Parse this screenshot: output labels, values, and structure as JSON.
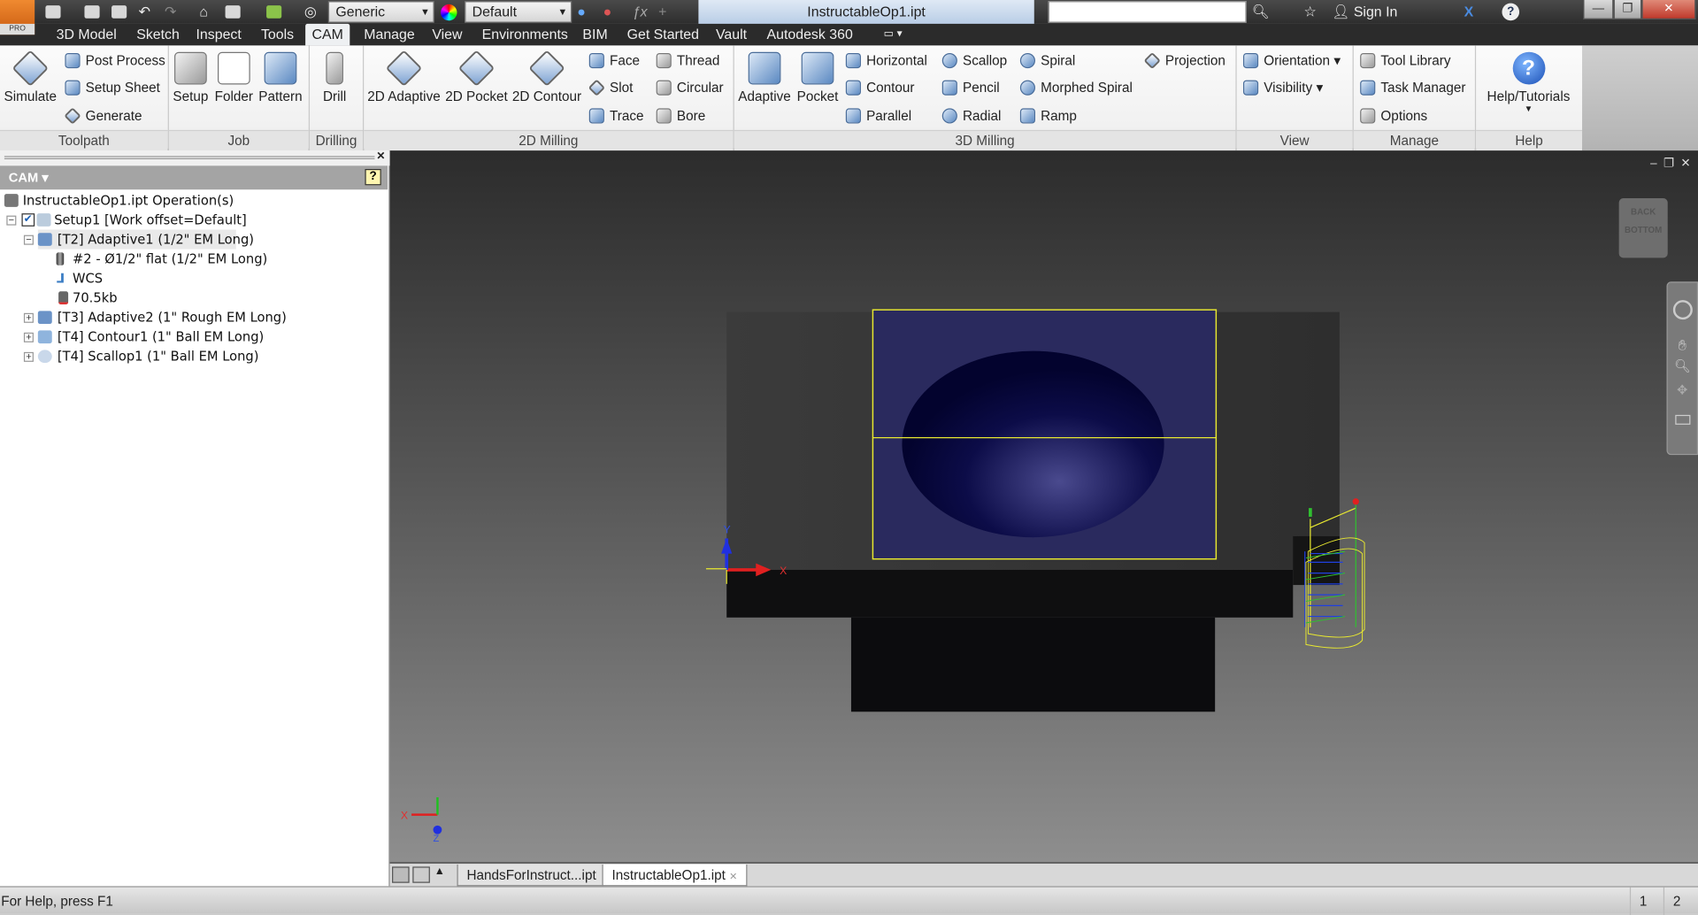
{
  "titlebar": {
    "logo_text": "PRO",
    "appearance_combo": "Generic",
    "style_combo": "Default",
    "document_title": "InstructableOp1.ipt",
    "search_value": "",
    "sign_in": "Sign In"
  },
  "menu": {
    "tabs": [
      "3D Model",
      "Sketch",
      "Inspect",
      "Tools",
      "CAM",
      "Manage",
      "View",
      "Environments",
      "BIM",
      "Get Started",
      "Vault",
      "Autodesk 360"
    ],
    "active": "CAM"
  },
  "ribbon": {
    "toolpath": {
      "label": "Toolpath",
      "simulate": "Simulate",
      "post_process": "Post Process",
      "setup_sheet": "Setup Sheet",
      "generate": "Generate"
    },
    "job": {
      "label": "Job",
      "setup": "Setup",
      "folder": "Folder",
      "pattern": "Pattern"
    },
    "drilling": {
      "label": "Drilling",
      "drill": "Drill"
    },
    "milling2d": {
      "label": "2D Milling",
      "adaptive": "2D Adaptive",
      "pocket": "2D Pocket",
      "contour": "2D Contour",
      "face": "Face",
      "slot": "Slot",
      "trace": "Trace",
      "thread": "Thread",
      "circular": "Circular",
      "bore": "Bore"
    },
    "milling3d": {
      "label": "3D Milling",
      "adaptive": "Adaptive",
      "pocket": "Pocket",
      "horizontal": "Horizontal",
      "contour": "Contour",
      "parallel": "Parallel",
      "scallop": "Scallop",
      "pencil": "Pencil",
      "radial": "Radial",
      "spiral": "Spiral",
      "morphed_spiral": "Morphed Spiral",
      "ramp": "Ramp",
      "projection": "Projection"
    },
    "view": {
      "label": "View",
      "orientation": "Orientation",
      "visibility": "Visibility"
    },
    "manage": {
      "label": "Manage",
      "tool_library": "Tool Library",
      "task_manager": "Task Manager",
      "options": "Options"
    },
    "help": {
      "label": "Help",
      "tutorials": "Help/Tutorials"
    }
  },
  "browser": {
    "title": "CAM",
    "tree": [
      {
        "text": "InstructableOp1.ipt Operation(s)"
      },
      {
        "text": "Setup1 [Work offset=Default]",
        "checked": true
      },
      {
        "text": "[T2] Adaptive1 (1/2\" EM Long)",
        "selected": true
      },
      {
        "text": "#2 - Ø1/2\" flat (1/2\" EM Long)"
      },
      {
        "text": "WCS"
      },
      {
        "text": "70.5kb"
      },
      {
        "text": "[T3] Adaptive2 (1\" Rough EM Long)"
      },
      {
        "text": "[T4] Contour1 (1\" Ball EM Long)"
      },
      {
        "text": "[T4] Scallop1 (1\" Ball EM Long)"
      }
    ]
  },
  "viewport": {
    "viewcube_top": "BACK",
    "viewcube_bottom": "BOTTOM",
    "axis_x": "X",
    "axis_y": "Y",
    "axis_z": "Z",
    "part_color": "#2a2a5e",
    "stock_outline_color": "#e8e830"
  },
  "doc_tabs": [
    {
      "label": "HandsForInstruct...ipt"
    },
    {
      "label": "InstructableOp1.ipt",
      "active": true
    }
  ],
  "status": {
    "help_text": "For Help, press F1",
    "page1": "1",
    "page2": "2"
  }
}
